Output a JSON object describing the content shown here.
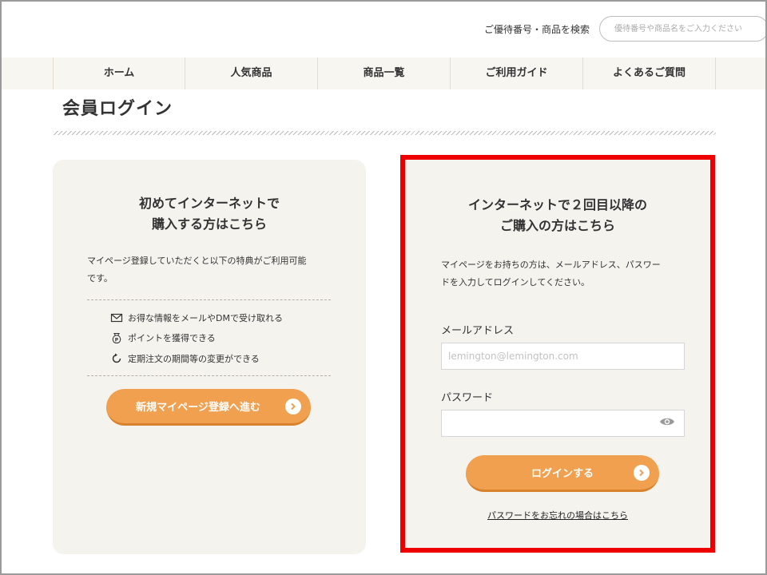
{
  "header": {
    "search_label": "ご優待番号・商品を検索",
    "search_placeholder": "優待番号や商品名をご入力ください"
  },
  "nav": {
    "items": [
      {
        "label": "ホーム"
      },
      {
        "label": "人気商品"
      },
      {
        "label": "商品一覧"
      },
      {
        "label": "ご利用ガイド"
      },
      {
        "label": "よくあるご質問"
      }
    ]
  },
  "page": {
    "title": "会員ログイン"
  },
  "new_member": {
    "heading_line1": "初めてインターネットで",
    "heading_line2": "購入する方はこちら",
    "description_line1": "マイページ登録していただくと以下の特典がご利用可能",
    "description_line2": "です。",
    "benefits": [
      {
        "icon": "mail-icon",
        "text": "お得な情報をメールやDMで受け取れる"
      },
      {
        "icon": "points-bag-icon",
        "text": "ポイントを獲得できる"
      },
      {
        "icon": "refresh-icon",
        "text": "定期注文の期間等の変更ができる"
      }
    ],
    "register_button": "新規マイページ登録へ進む"
  },
  "login": {
    "heading_line1": "インターネットで２回目以降の",
    "heading_line2": "ご購入の方はこちら",
    "description_line1": "マイページをお持ちの方は、メールアドレス、パスワー",
    "description_line2": "ドを入力してログインしてください。",
    "email_label": "メールアドレス",
    "email_placeholder": "lemington@lemington.com",
    "password_label": "パスワード",
    "password_value": "",
    "login_button": "ログインする",
    "forgot_link": "パスワードをお忘れの場合はこちら"
  },
  "colors": {
    "accent_orange": "#f0a04e",
    "panel_bg": "#f5f3ee",
    "highlight_border": "#ee0000"
  }
}
